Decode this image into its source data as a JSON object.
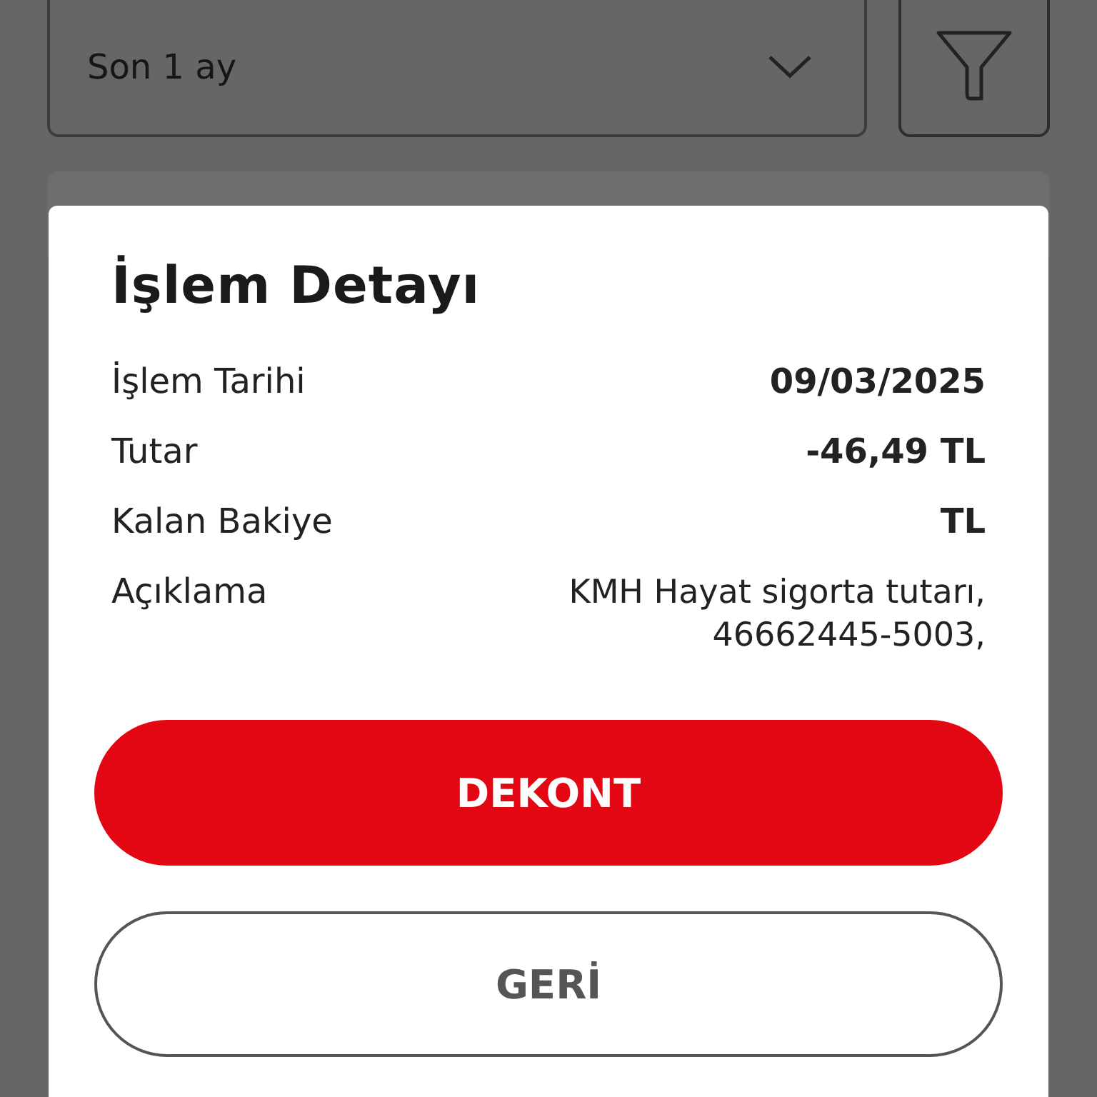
{
  "filter": {
    "period": "Son 1 ay"
  },
  "dialog": {
    "title": "İşlem Detayı",
    "rows": [
      {
        "label": "İşlem Tarihi",
        "value": "09/03/2025",
        "bold": true
      },
      {
        "label": "Tutar",
        "value": "-46,49 TL",
        "bold": true
      },
      {
        "label": "Kalan Bakiye",
        "value": "TL",
        "bold": true
      },
      {
        "label": "Açıklama",
        "value": "KMH Hayat sigorta tutarı, 46662445-5003,",
        "bold": false
      }
    ],
    "buttons": [
      {
        "label": "DEKONT",
        "kind": "primary"
      },
      {
        "label": "GERİ",
        "kind": "secondary"
      }
    ]
  }
}
